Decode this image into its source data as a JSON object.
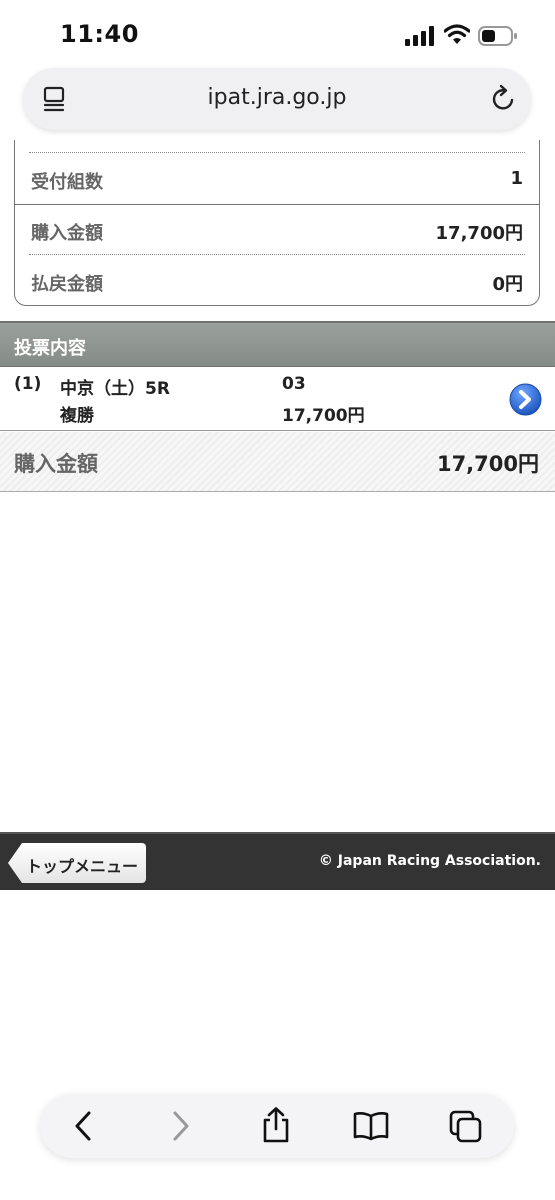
{
  "status_bar": {
    "time": "11:40"
  },
  "address_bar": {
    "url": "ipat.jra.go.jp"
  },
  "summary": [
    {
      "label": "受付組数",
      "value": "1"
    },
    {
      "label": "購入金額",
      "value": "17,700円"
    },
    {
      "label": "払戻金額",
      "value": "0円"
    }
  ],
  "section": {
    "title": "投票内容"
  },
  "bet": {
    "index": "(1)",
    "race": "中京（土）5R",
    "bet_type": "複勝",
    "horse": "03",
    "amount": "17,700円"
  },
  "total": {
    "label": "購入金額",
    "value": "17,700円"
  },
  "footer": {
    "top_menu_label": "トップメニュー",
    "copyright": "© Japan Racing Association."
  },
  "colors": {
    "section_header": "#8e9490",
    "footer_bg": "#333333",
    "arrow_blue": "#2f6fd6"
  }
}
